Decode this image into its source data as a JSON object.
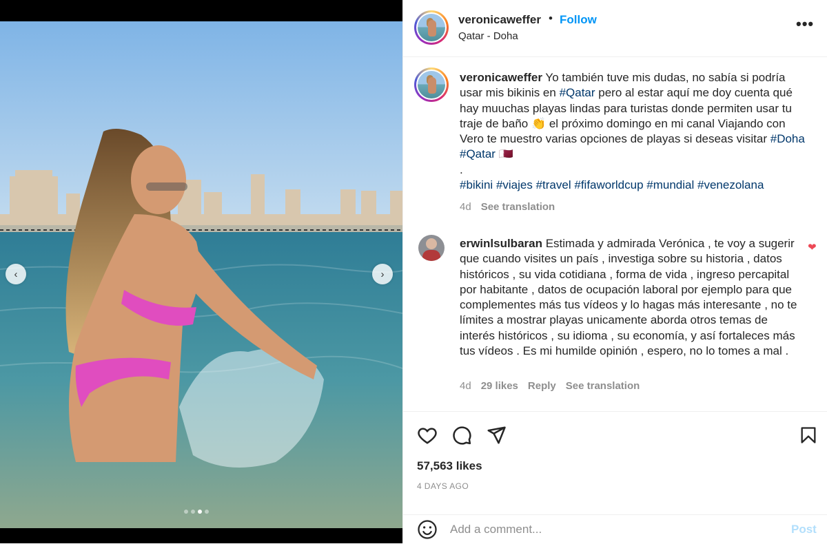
{
  "post": {
    "username": "veronicaweffer",
    "separator": "•",
    "follow_label": "Follow",
    "location": "Qatar - Doha",
    "more_label": "•••"
  },
  "caption": {
    "username": "veronicaweffer",
    "text_1": " Yo también tuve mis dudas, no sabía si podría usar mis bikinis en ",
    "tag_qatar_1": "#Qatar",
    "text_2": " pero al estar aquí me doy cuenta qué hay muuchas playas lindas para turistas donde permiten usar tu traje de baño 👏 el próximo domingo en mi canal Viajando con Vero te muestro varias opciones de playas si deseas visitar ",
    "tag_doha": "#Doha",
    "tag_qatar_2": "#Qatar",
    "flag": "🇶🇦",
    "dot_line": ".",
    "hashtags": [
      "#bikini",
      "#viajes",
      "#travel",
      "#fifaworldcup",
      "#mundial",
      "#venezolana"
    ],
    "age": "4d",
    "see_translation": "See translation"
  },
  "comment": {
    "username": "erwinlsulbaran",
    "text": " Estimada y admirada Verónica , te voy a sugerir que cuando visites un país , investiga sobre su historia , datos históricos , su vida cotidiana , forma de vida , ingreso percapital por habitante , datos de ocupación laboral por ejemplo para que complementes más tus vídeos y lo hagas más interesante , no te límites a mostrar playas unicamente aborda otros temas de interés históricos , su idioma , su economía, y así fortaleces más tus vídeos . Es mi humilde opinión , espero, no lo tomes a mal .",
    "age": "4d",
    "likes": "29 likes",
    "reply": "Reply",
    "see_translation": "See translation",
    "liked_icon": "heart-filled-icon"
  },
  "actions": {
    "likes": "57,563 likes",
    "time_ago": "4 DAYS AGO",
    "icons": [
      "heart-icon",
      "comment-icon",
      "share-icon",
      "bookmark-icon"
    ]
  },
  "add_comment": {
    "placeholder": "Add a comment...",
    "post_label": "Post"
  },
  "media": {
    "prev_label": "‹",
    "next_label": "›",
    "carousel_count": 4,
    "carousel_active_index": 2
  },
  "colors": {
    "link_blue": "#0095f6",
    "hashtag": "#00376b",
    "muted": "#8e8e8e",
    "like_red": "#ed4956"
  }
}
